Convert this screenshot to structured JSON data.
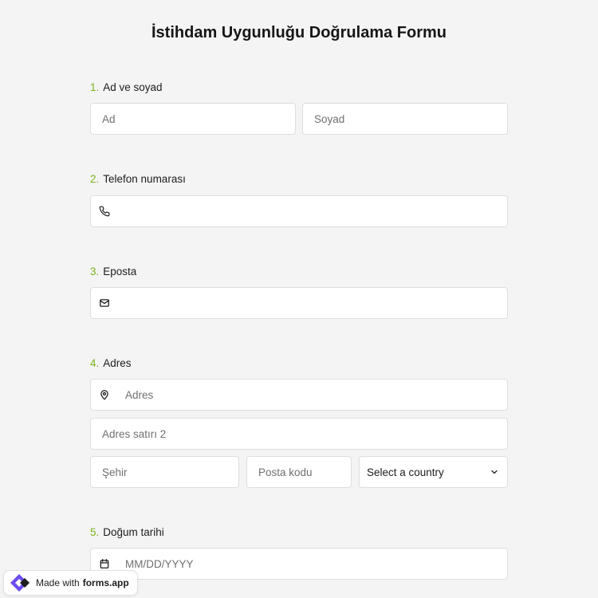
{
  "form": {
    "title": "İstihdam Uygunluğu Doğrulama Formu",
    "questions": [
      {
        "number": "1.",
        "label": "Ad ve soyad",
        "first_placeholder": "Ad",
        "last_placeholder": "Soyad"
      },
      {
        "number": "2.",
        "label": "Telefon numarası",
        "icon": "phone-icon"
      },
      {
        "number": "3.",
        "label": "Eposta",
        "icon": "mail-icon"
      },
      {
        "number": "4.",
        "label": "Adres",
        "address_placeholder": "Adres",
        "address2_placeholder": "Adres satırı 2",
        "city_placeholder": "Şehir",
        "zip_placeholder": "Posta kodu",
        "country_selected": "Select a country",
        "icon": "map-pin-icon"
      },
      {
        "number": "5.",
        "label": "Doğum tarihi",
        "date_placeholder": "MM/DD/YYYY",
        "icon": "calendar-icon"
      }
    ]
  },
  "badge": {
    "prefix": "Made with",
    "brand": "forms.app"
  },
  "colors": {
    "accent": "#7ab51d",
    "background": "#f4f4f4",
    "border": "#dedede",
    "brand": "#6c4cf1"
  }
}
